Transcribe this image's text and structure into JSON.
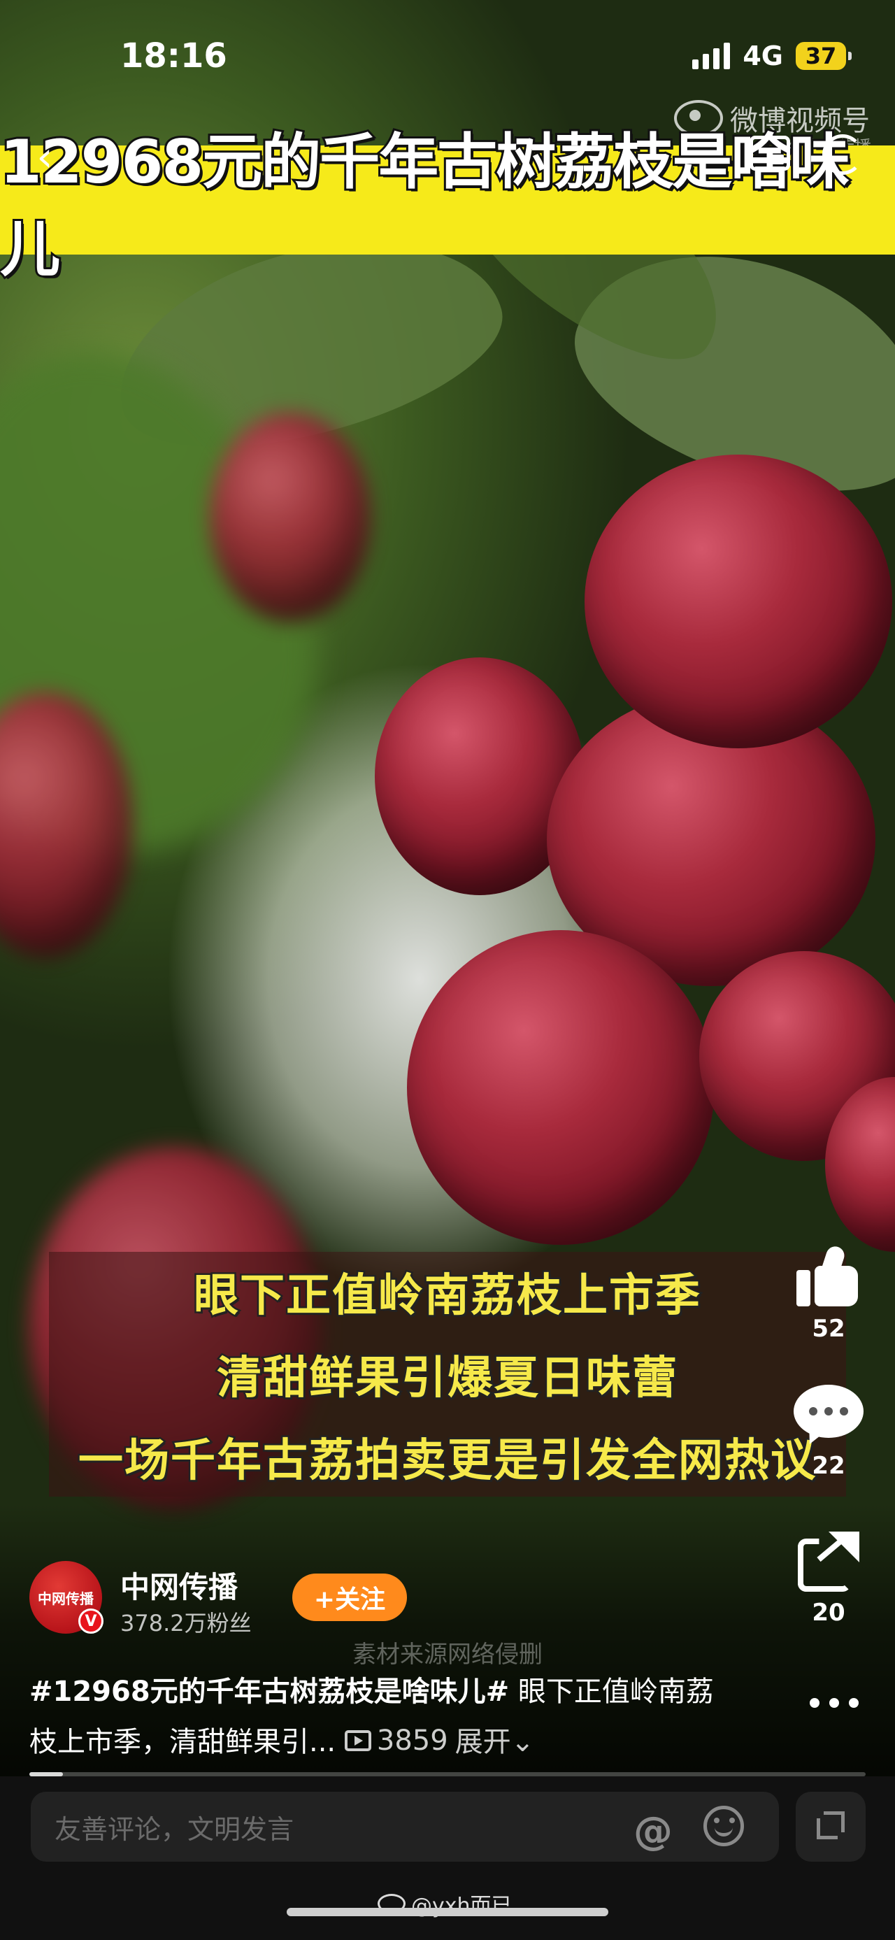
{
  "status_bar": {
    "time": "18:16",
    "network": "4G",
    "battery": "37"
  },
  "watermark": {
    "brand": "微博视频号",
    "sub": "@中网传播"
  },
  "video": {
    "title": "12968元的千年古树荔枝是啥味儿",
    "subtitles": [
      "眼下正值岭南荔枝上市季",
      "清甜鲜果引爆夏日味蕾",
      "一场千年古荔拍卖更是引发全网热议"
    ],
    "source_note": "素材来源网络侵删",
    "progress_fraction": 0.04
  },
  "actions": {
    "likes": "52",
    "comments": "22",
    "shares": "20"
  },
  "author": {
    "avatar_text": "中网传播",
    "verified_mark": "V",
    "name": "中网传播",
    "fans": "378.2万粉丝",
    "follow_label": "+关注"
  },
  "description": {
    "hashtag": "#12968元的千年古树荔枝是啥味儿#",
    "text": " 眼下正值岭南荔枝上市季，清甜鲜果引...",
    "play_count": "3859",
    "expand_label": "展开⌄"
  },
  "comment_bar": {
    "placeholder": "友善评论，文明发言",
    "at_symbol": "@"
  },
  "footer": {
    "user_watermark": "@yxh而已"
  },
  "icons": [
    "back-icon",
    "pip-icon",
    "refresh-icon",
    "like-icon",
    "comment-icon",
    "share-icon",
    "more-icon",
    "play-icon",
    "at-icon",
    "emoji-icon",
    "fullscreen-icon",
    "weibo-eye-icon"
  ]
}
